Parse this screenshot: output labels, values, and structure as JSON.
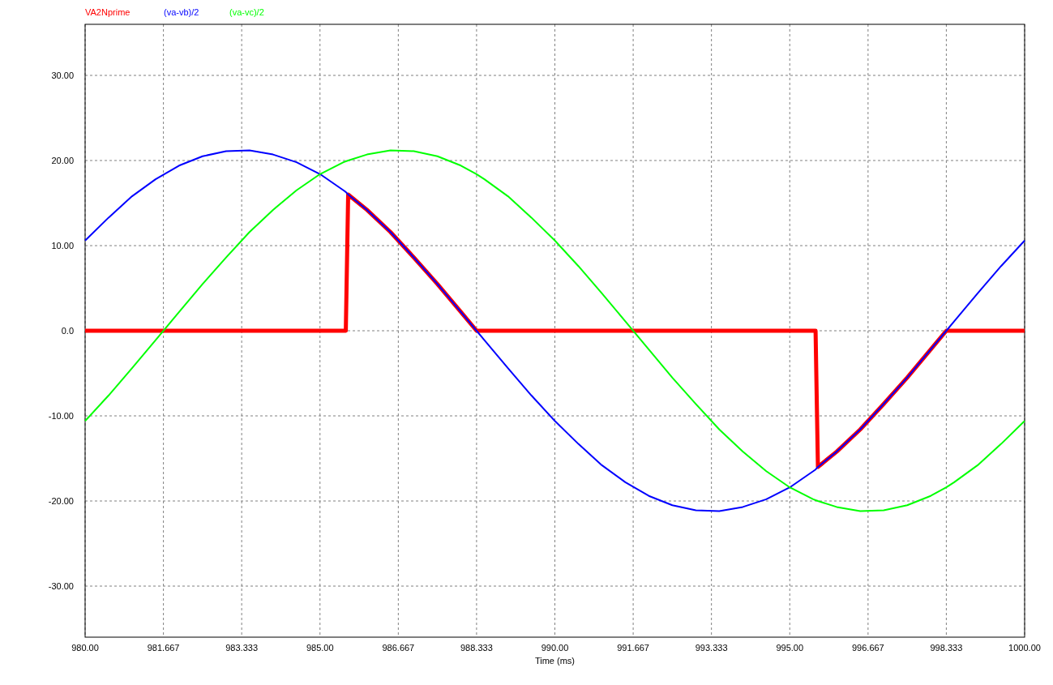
{
  "chart": {
    "chart_data": {
      "type": "line",
      "xlabel": "Time (ms)",
      "grid": true,
      "x": [
        980,
        980.5,
        981,
        981.5,
        982,
        982.5,
        983,
        983.5,
        984,
        984.5,
        985,
        985.5,
        985.55,
        985.6,
        986,
        986.5,
        987,
        987.5,
        988,
        988.333,
        988.5,
        989,
        989.5,
        990,
        990.5,
        991,
        991.5,
        992,
        992.5,
        993,
        993.5,
        994,
        994.5,
        995,
        995.5,
        995.55,
        995.6,
        996,
        996.5,
        997,
        997.5,
        998,
        998.333,
        998.5,
        999,
        999.5,
        1000
      ],
      "series": [
        {
          "name": "VA2Nprime",
          "color": "#ff0000",
          "values": [
            0,
            0,
            0,
            0,
            0,
            0,
            0,
            0,
            0,
            0,
            0,
            0,
            0,
            16,
            14.2,
            11.6,
            8.6,
            5.5,
            2.2,
            0,
            0,
            0,
            0,
            0,
            0,
            0,
            0,
            0,
            0,
            0,
            0,
            0,
            0,
            0,
            0,
            0,
            -16,
            -14.2,
            -11.6,
            -8.6,
            -5.5,
            -2.2,
            0,
            0,
            0,
            0,
            0
          ]
        },
        {
          "name": "(va-vb)/2",
          "color": "#0000ff",
          "values": [
            10.6,
            13.3,
            15.8,
            17.8,
            19.4,
            20.5,
            21.1,
            21.2,
            20.7,
            19.8,
            18.4,
            16.5,
            16.3,
            16,
            14.2,
            11.6,
            8.6,
            5.5,
            2.2,
            0,
            -1.1,
            -4.4,
            -7.6,
            -10.6,
            -13.3,
            -15.8,
            -17.8,
            -19.4,
            -20.5,
            -21.1,
            -21.2,
            -20.7,
            -19.8,
            -18.4,
            -16.5,
            -16.3,
            -16,
            -14.2,
            -11.6,
            -8.6,
            -5.5,
            -2.2,
            0,
            1.1,
            4.4,
            7.6,
            10.6
          ]
        },
        {
          "name": "(va-vc)/2",
          "color": "#00ff00",
          "values": [
            -10.6,
            -7.6,
            -4.4,
            -1.1,
            2.2,
            5.5,
            8.6,
            11.6,
            14.2,
            16.5,
            18.4,
            19.8,
            19.9,
            20,
            20.7,
            21.2,
            21.1,
            20.5,
            19.4,
            18.4,
            17.8,
            15.8,
            13.3,
            10.6,
            7.6,
            4.4,
            1.1,
            -2.2,
            -5.5,
            -8.6,
            -11.6,
            -14.2,
            -16.5,
            -18.4,
            -19.8,
            -19.9,
            -20,
            -20.7,
            -21.2,
            -21.1,
            -20.5,
            -19.4,
            -18.4,
            -17.8,
            -15.8,
            -13.3,
            -10.6
          ]
        }
      ],
      "xlim": [
        980,
        1000
      ],
      "ylim": [
        -36,
        36
      ],
      "xticks": [
        {
          "value": 980,
          "label": "980.00"
        },
        {
          "value": 981.667,
          "label": "981.667"
        },
        {
          "value": 983.333,
          "label": "983.333"
        },
        {
          "value": 985,
          "label": "985.00"
        },
        {
          "value": 986.667,
          "label": "986.667"
        },
        {
          "value": 988.333,
          "label": "988.333"
        },
        {
          "value": 990,
          "label": "990.00"
        },
        {
          "value": 991.667,
          "label": "991.667"
        },
        {
          "value": 993.333,
          "label": "993.333"
        },
        {
          "value": 995,
          "label": "995.00"
        },
        {
          "value": 996.667,
          "label": "996.667"
        },
        {
          "value": 998.333,
          "label": "998.333"
        },
        {
          "value": 1000,
          "label": "1000.00"
        }
      ],
      "yticks": [
        {
          "value": 30,
          "label": "30.00"
        },
        {
          "value": 20,
          "label": "20.00"
        },
        {
          "value": 10,
          "label": "10.00"
        },
        {
          "value": 0,
          "label": "0.0"
        },
        {
          "value": -10,
          "label": "-10.00"
        },
        {
          "value": -20,
          "label": "-20.00"
        },
        {
          "value": -30,
          "label": "-30.00"
        }
      ]
    }
  }
}
